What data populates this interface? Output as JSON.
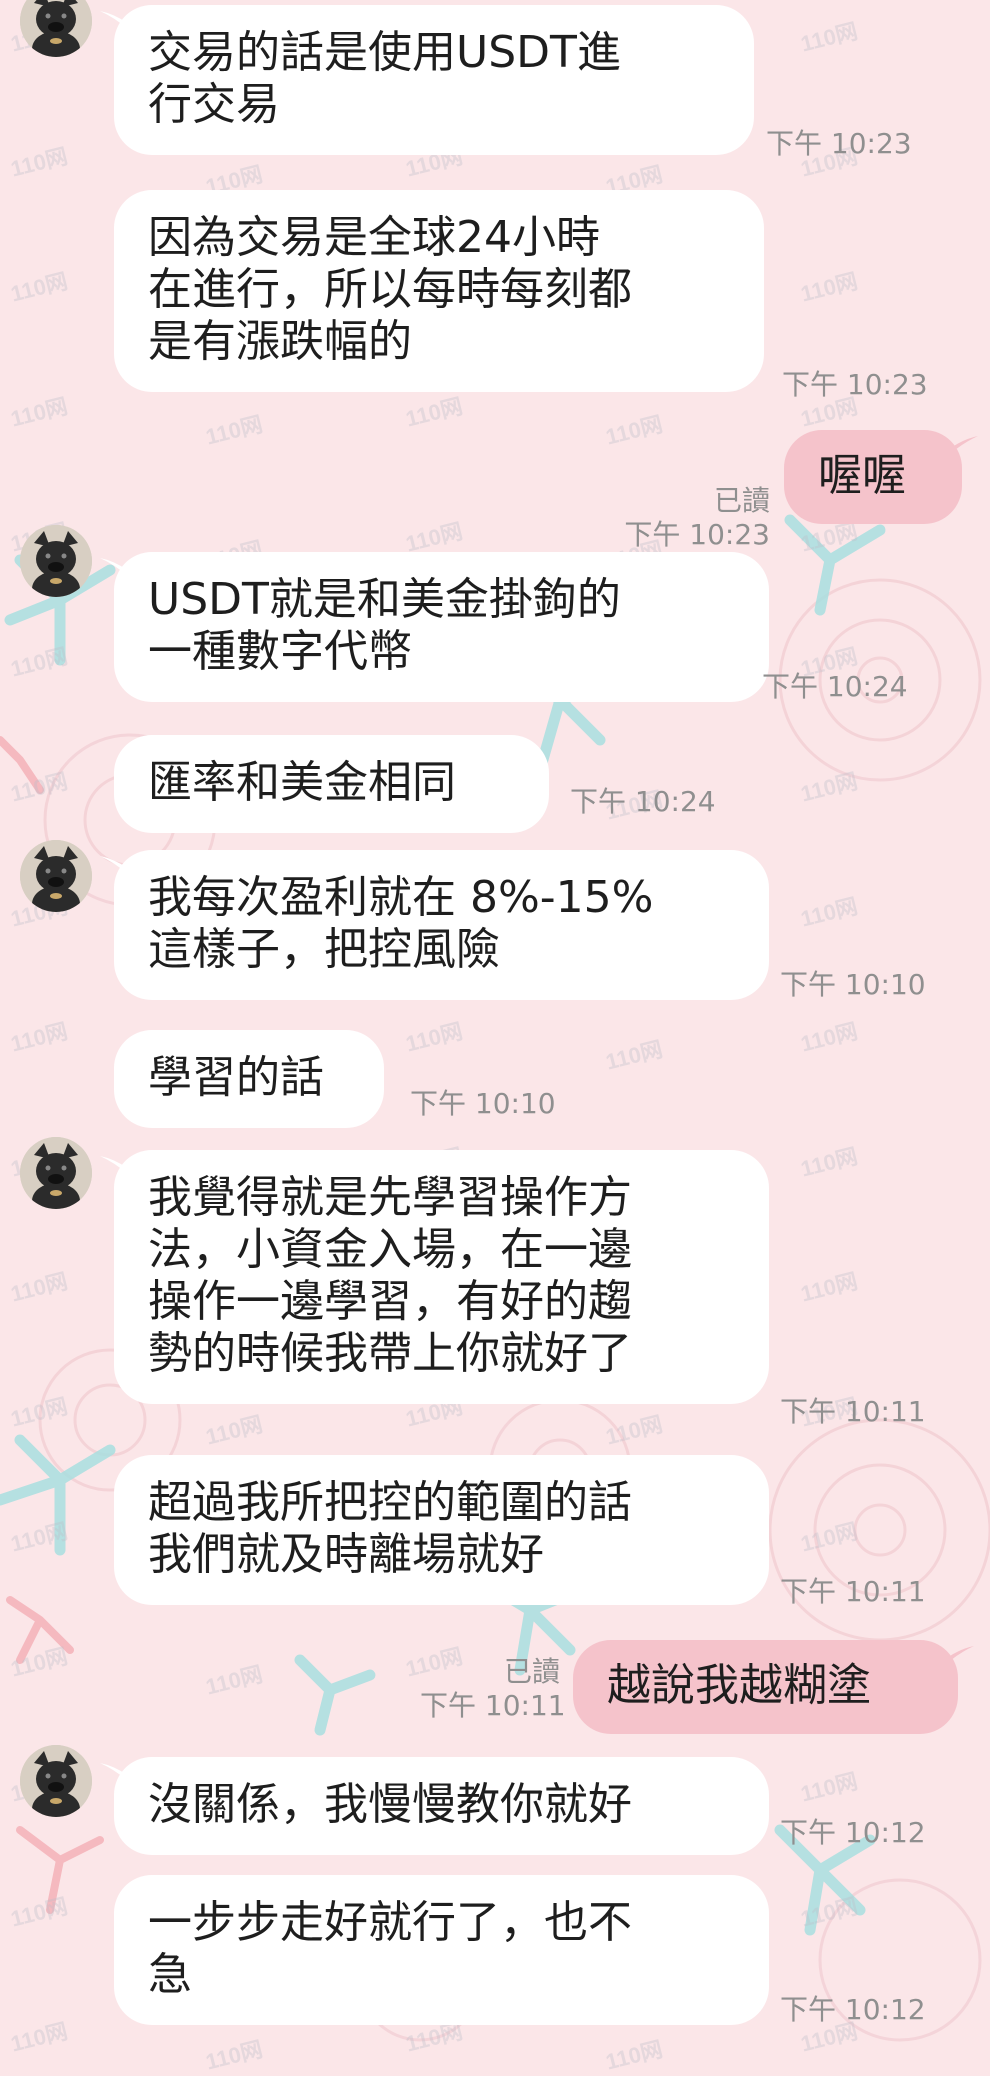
{
  "watermark": "110网",
  "chat": {
    "messages": [
      {
        "side": "in",
        "avatar": true,
        "lines": [
          "交易的話是使用USDT進",
          "行交易"
        ],
        "time": "下午 10:23"
      },
      {
        "side": "in",
        "avatar": false,
        "lines": [
          "因為交易是全球24小時",
          "在進行，所以每時每刻都",
          "是有漲跌幅的"
        ],
        "time": "下午 10:23"
      },
      {
        "side": "out",
        "lines": [
          "喔喔"
        ],
        "read": "已讀",
        "time": "下午 10:23"
      },
      {
        "side": "in",
        "avatar": true,
        "lines": [
          "USDT就是和美金掛鉤的",
          "一種數字代幣"
        ],
        "time": "下午 10:24"
      },
      {
        "side": "in",
        "avatar": false,
        "lines": [
          "匯率和美金相同"
        ],
        "time": "下午 10:24"
      },
      {
        "side": "in",
        "avatar": true,
        "lines": [
          "我每次盈利就在 8%-15%",
          "這樣子，把控風險"
        ],
        "time": "下午 10:10"
      },
      {
        "side": "in",
        "avatar": false,
        "lines": [
          "學習的話"
        ],
        "time": "下午 10:10"
      },
      {
        "side": "in",
        "avatar": true,
        "lines": [
          "我覺得就是先學習操作方",
          "法，小資金入場，在一邊",
          "操作一邊學習，有好的趨",
          "勢的時候我帶上你就好了"
        ],
        "time": "下午 10:11"
      },
      {
        "side": "in",
        "avatar": false,
        "lines": [
          "超過我所把控的範圍的話",
          "我們就及時離場就好"
        ],
        "time": "下午 10:11"
      },
      {
        "side": "out",
        "lines": [
          "越說我越糊塗"
        ],
        "read": "已讀",
        "time": "下午 10:11"
      },
      {
        "side": "in",
        "avatar": true,
        "lines": [
          "沒關係，我慢慢教你就好"
        ],
        "time": "下午 10:12"
      },
      {
        "side": "in",
        "avatar": false,
        "lines": [
          "一步步走好就行了，也不",
          "急"
        ],
        "time": "下午 10:12"
      }
    ]
  },
  "colors": {
    "background": "#fbe6e8",
    "incoming_bubble": "#ffffff",
    "outgoing_bubble": "#f5c3cb",
    "meta_text": "#8f8f8f",
    "decoration_teal": "#a9dfe0",
    "decoration_pink": "#f6cfd4"
  }
}
